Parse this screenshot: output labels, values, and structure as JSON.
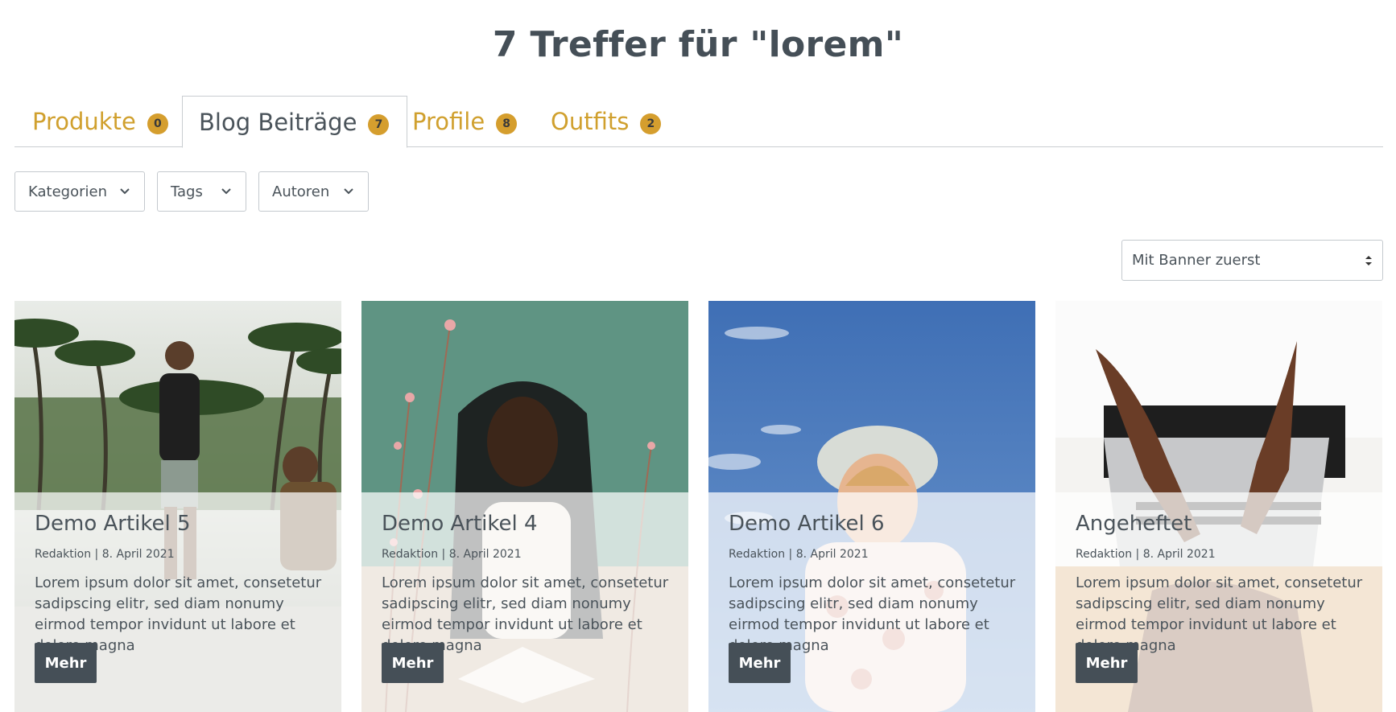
{
  "page": {
    "title": "7 Treffer für \"lorem\""
  },
  "tabs": [
    {
      "label": "Produkte",
      "count": "0",
      "active": false
    },
    {
      "label": "Blog Beiträge",
      "count": "7",
      "active": true
    },
    {
      "label": "Profile",
      "count": "8",
      "active": false
    },
    {
      "label": "Outfits",
      "count": "2",
      "active": false
    }
  ],
  "filters": [
    {
      "label": "Kategorien",
      "icon": "chevron-down-icon"
    },
    {
      "label": "Tags",
      "icon": "chevron-down-icon"
    },
    {
      "label": "Autoren",
      "icon": "chevron-down-icon"
    }
  ],
  "sort": {
    "selected": "Mit Banner zuerst"
  },
  "cards": [
    {
      "title": "Demo Artikel 5",
      "meta": "Redaktion | 8. April 2021",
      "excerpt": "Lorem ipsum dolor sit amet, consetetur sadipscing elitr, sed diam nonumy eirmod tempor invidunt ut labore et dolore magna",
      "button": "Mehr"
    },
    {
      "title": "Demo Artikel 4",
      "meta": "Redaktion | 8. April 2021",
      "excerpt": "Lorem ipsum dolor sit amet, consetetur sadipscing elitr, sed diam nonumy eirmod tempor invidunt ut labore et dolore magna",
      "button": "Mehr"
    },
    {
      "title": "Demo Artikel 6",
      "meta": "Redaktion | 8. April 2021",
      "excerpt": "Lorem ipsum dolor sit amet, consetetur sadipscing elitr, sed diam nonumy eirmod tempor invidunt ut labore et dolore magna",
      "button": "Mehr"
    },
    {
      "title": "Angeheftet",
      "meta": "Redaktion | 8. April 2021",
      "excerpt": "Lorem ipsum dolor sit amet, consetetur sadipscing elitr, sed diam nonumy eirmod tempor invidunt ut labore et dolore magna",
      "button": "Mehr"
    }
  ],
  "colors": {
    "accent": "#d0a02e",
    "badge": "#d59e2e",
    "text": "#4a535a",
    "button": "#454f57"
  }
}
